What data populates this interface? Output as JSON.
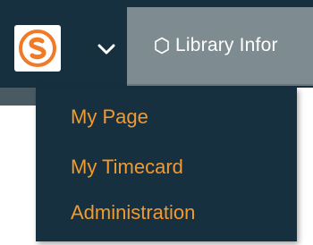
{
  "header": {
    "logo_icon": "s-brand-logo-icon",
    "menu_toggle_icon": "chevron-down-icon",
    "tab": {
      "icon": "hexagon-icon",
      "label": "Library Infor"
    }
  },
  "dropdown": {
    "items": [
      {
        "label": "My Page"
      },
      {
        "label": "My Timecard"
      },
      {
        "label": "Administration"
      }
    ]
  },
  "colors": {
    "header_bg": "#17303f",
    "tab_bg": "#7e8c92",
    "menu_text": "#f29a2e",
    "logo_orange": "#f07a25"
  }
}
